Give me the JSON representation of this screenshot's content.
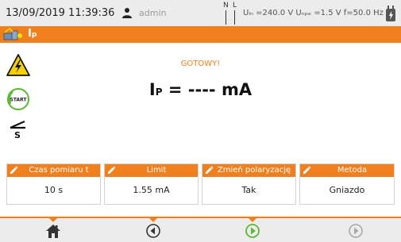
{
  "status_bar": {
    "datetime": "13/09/2019 11:39:36",
    "user_icon": "user-icon",
    "username": "admin",
    "n_label": "N",
    "l_label": "L",
    "voltages": "Uₗₙ =240.0 V Uₙₚₑ =1.5 V f=50.0 Hz",
    "battery_icon": "plug-icon"
  },
  "title_bar": {
    "icon": "rcd-meter-icon",
    "title_main": "I",
    "title_sub": "p"
  },
  "left_icons": [
    "high-voltage-warning-icon",
    "start-icon",
    "probe-icon"
  ],
  "probe_label": "S",
  "start_label": "START",
  "main": {
    "status": "GOTOWY!",
    "reading_symbol": "I",
    "reading_sub": "P",
    "reading_value": " = ---- mA"
  },
  "params": [
    {
      "label": "Czas pomiaru t",
      "value": "10 s"
    },
    {
      "label": "Limit",
      "value": "1.55 mA"
    },
    {
      "label": "Zmień polaryzację",
      "value": "Tak"
    },
    {
      "label": "Metoda",
      "value": "Gniazdo"
    }
  ],
  "nav": [
    "home-icon",
    "back-icon",
    "start-measurement-icon",
    "next-icon"
  ],
  "colors": {
    "accent": "#f07f1e",
    "bar_bg": "#ececec",
    "start_green": "#5cb734",
    "warning_yellow": "#f6d000"
  }
}
